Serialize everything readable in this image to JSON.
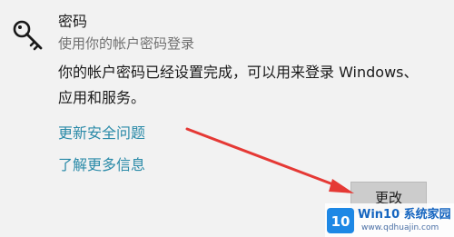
{
  "setting": {
    "title": "密码",
    "subtitle": "使用你的帐户密码登录",
    "description": "你的帐户密码已经设置完成，可以用来登录 Windows、应用和服务。",
    "links": [
      "更新安全问题",
      "了解更多信息"
    ],
    "change_button_label": "更改",
    "icon": "key-icon"
  },
  "annotation": {
    "arrow_color": "#e53935"
  },
  "watermark": {
    "logo_text": "10",
    "title": "Win10 系统家园",
    "url": "www.qdhuajin.com"
  },
  "colors": {
    "background": "#f2f2f2",
    "link": "#2a8aa8",
    "button": "#cccccc"
  }
}
